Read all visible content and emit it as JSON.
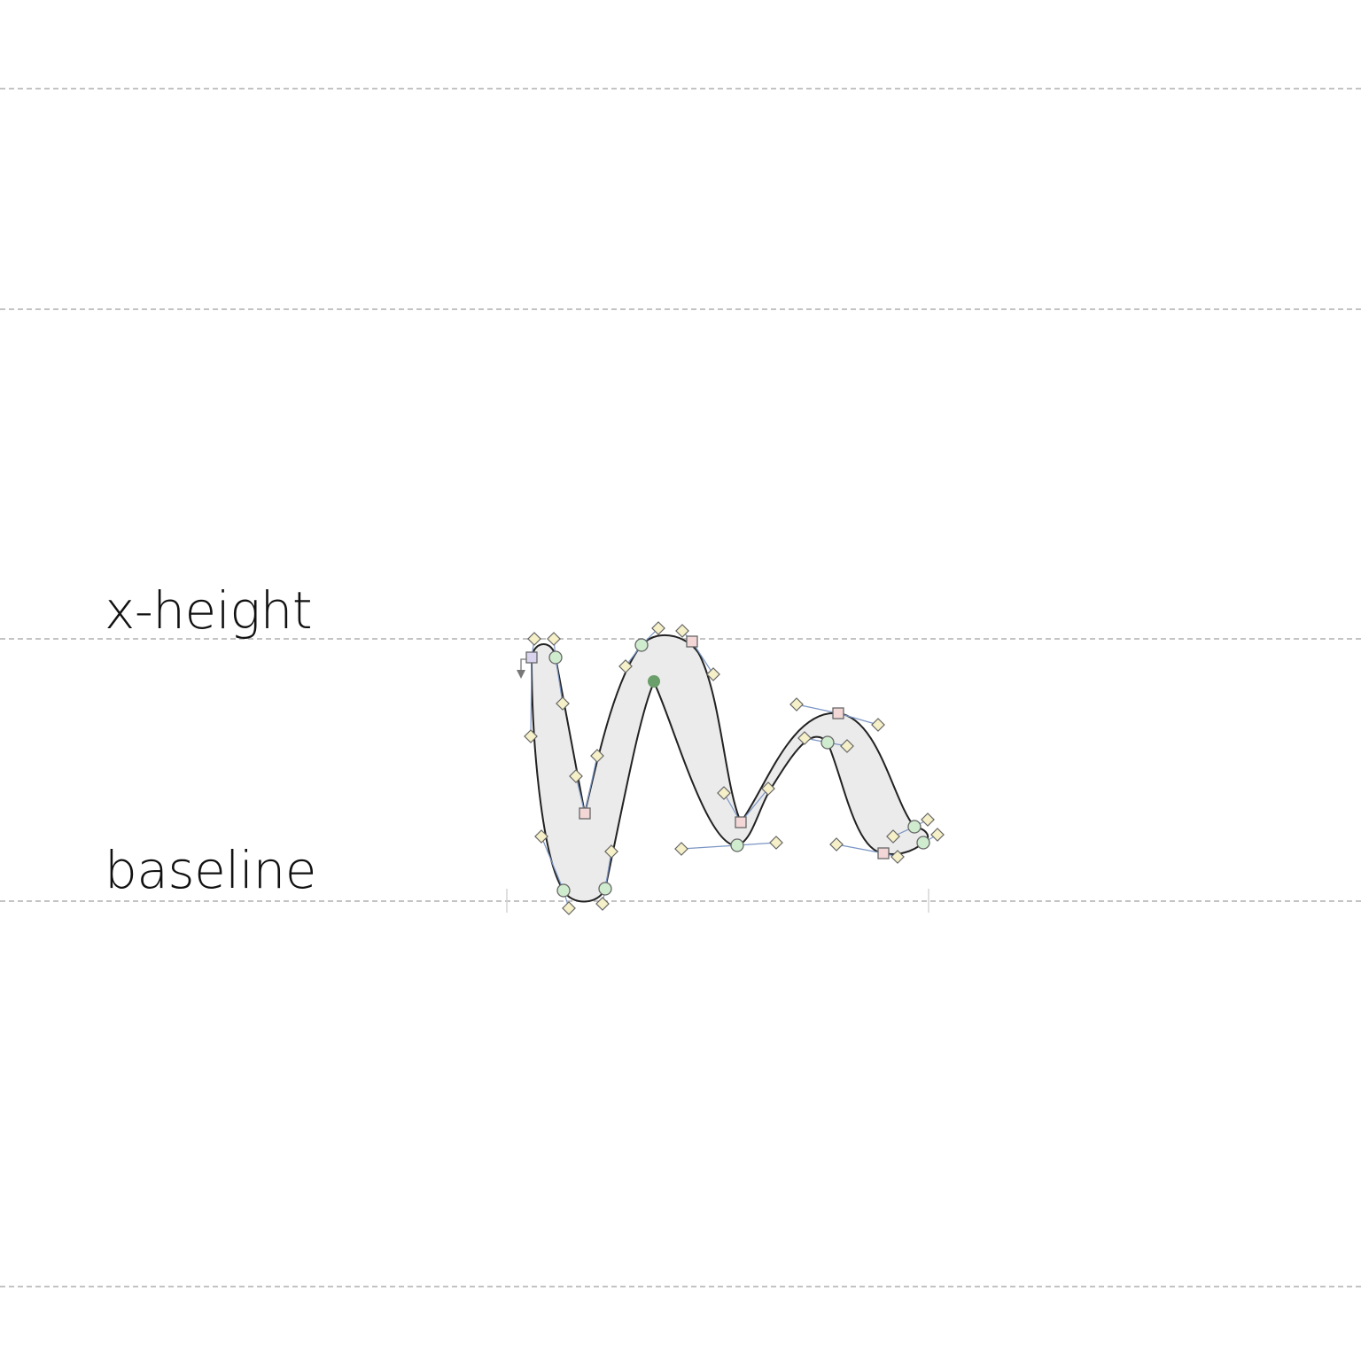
{
  "guides": {
    "x_height_label": "x-height",
    "baseline_label": "baseline"
  },
  "colors": {
    "guide": "#c3c3c3",
    "glyph_fill": "#ebebeb",
    "glyph_stroke": "#222222",
    "handle_line": "#7a95c4",
    "smooth_point": "#cfeccf",
    "corner_point": "#f3d7d7",
    "start_point": "#d9d3ee",
    "off_curve": "#f5f0c8",
    "anchor": "#6a9e6a"
  },
  "icons": {
    "smooth_point": "circle",
    "corner_point": "square",
    "off_curve_point": "diamond",
    "start_point": "square-with-direction-arrow",
    "anchor": "filled-dot"
  }
}
